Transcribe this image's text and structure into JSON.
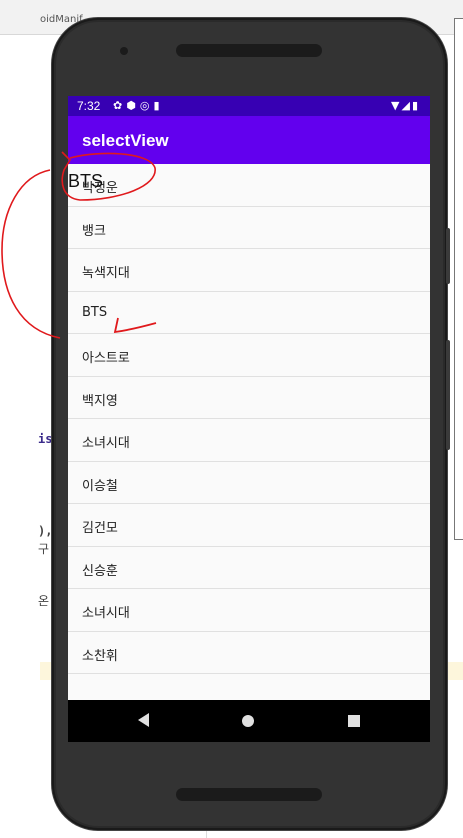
{
  "ide": {
    "tab_label": "oidManif",
    "frag_1": "is",
    "frag_2": "),",
    "frag_3": "구",
    "frag_4": "온"
  },
  "status_bar": {
    "time": "7:32",
    "left_icons": [
      "gear-icon",
      "shield-icon",
      "at-icon",
      "sd-card-icon"
    ],
    "right_icons": [
      "wifi-icon",
      "signal-icon",
      "battery-icon"
    ]
  },
  "app_bar": {
    "title": "selectView"
  },
  "list": {
    "items": [
      "박정운",
      "뱅크",
      "녹색지대",
      "BTS",
      "아스트로",
      "백지영",
      "소녀시대",
      "이승철",
      "김건모",
      "신승훈",
      "소녀시대",
      "소찬휘"
    ]
  },
  "selected_text": "BTS",
  "colors": {
    "status_bar": "#3700b3",
    "app_bar": "#6200ee",
    "annotation": "#e0191c"
  }
}
